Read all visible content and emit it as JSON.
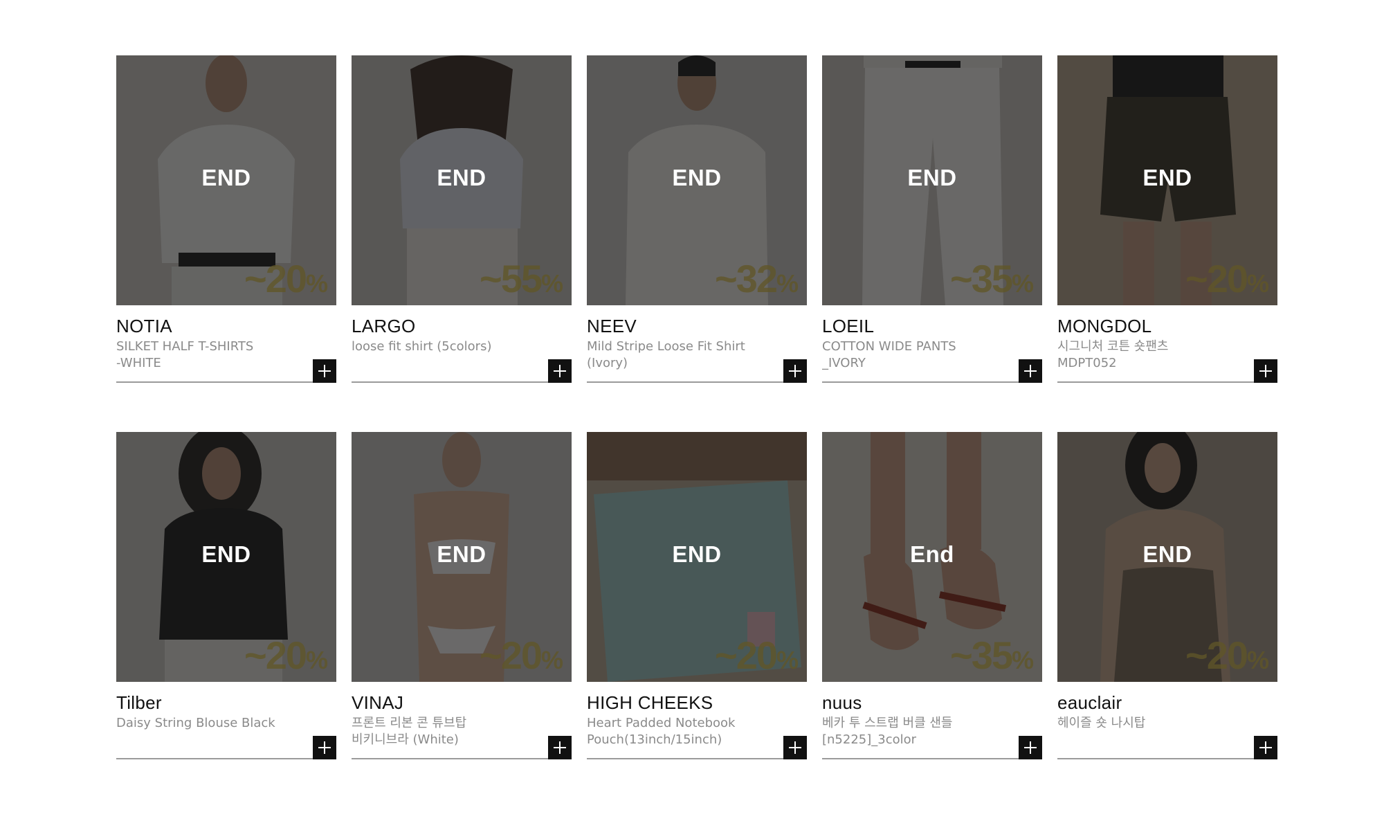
{
  "colors": {
    "overlay": "#141414",
    "discount_text": "#605628",
    "button_bg": "#111111",
    "brand_text": "#111111",
    "product_text": "#8a8a8a",
    "divider": "#9a9a9a"
  },
  "products": [
    {
      "brand": "NOTIA",
      "name": "SILKET HALF T-SHIRTS\n-WHITE",
      "status": "END",
      "discount": "~20",
      "pct": "%",
      "photo": "model-white-tee"
    },
    {
      "brand": "LARGO",
      "name": "loose fit shirt (5colors)",
      "status": "END",
      "discount": "~55",
      "pct": "%",
      "photo": "model-shirt"
    },
    {
      "brand": "NEEV",
      "name": "Mild Stripe Loose Fit Shirt\n(Ivory)",
      "status": "END",
      "discount": "~32",
      "pct": "%",
      "photo": "model-stripe-shirt"
    },
    {
      "brand": "LOEIL",
      "name": "COTTON WIDE PANTS\n_IVORY",
      "status": "END",
      "discount": "~35",
      "pct": "%",
      "photo": "wide-pants"
    },
    {
      "brand": "MONGDOL",
      "name": "시그니처 코튼 숏팬츠\nMDPT052",
      "status": "END",
      "discount": "~20",
      "pct": "%",
      "photo": "short-pants"
    },
    {
      "brand": "Tilber",
      "name": "Daisy String Blouse Black",
      "status": "END",
      "discount": "~20",
      "pct": "%",
      "photo": "model-black-blouse"
    },
    {
      "brand": "VINAJ",
      "name": "프론트 리본 콘 튜브탑\n비키니브라 (White)",
      "status": "END",
      "discount": "~20",
      "pct": "%",
      "photo": "model-bikini"
    },
    {
      "brand": "HIGH CHEEKS",
      "name": "Heart Padded Notebook\nPouch(13inch/15inch)",
      "status": "END",
      "discount": "~20",
      "pct": "%",
      "photo": "notebook-pouch"
    },
    {
      "brand": "nuus",
      "name": "베카 투 스트랩 버클 샌들\n[n5225]_3color",
      "status": "End",
      "discount": "~35",
      "pct": "%",
      "photo": "sandals"
    },
    {
      "brand": "eauclair",
      "name": "헤이즐 숏 나시탑",
      "status": "END",
      "discount": "~20",
      "pct": "%",
      "photo": "model-camisole"
    }
  ]
}
